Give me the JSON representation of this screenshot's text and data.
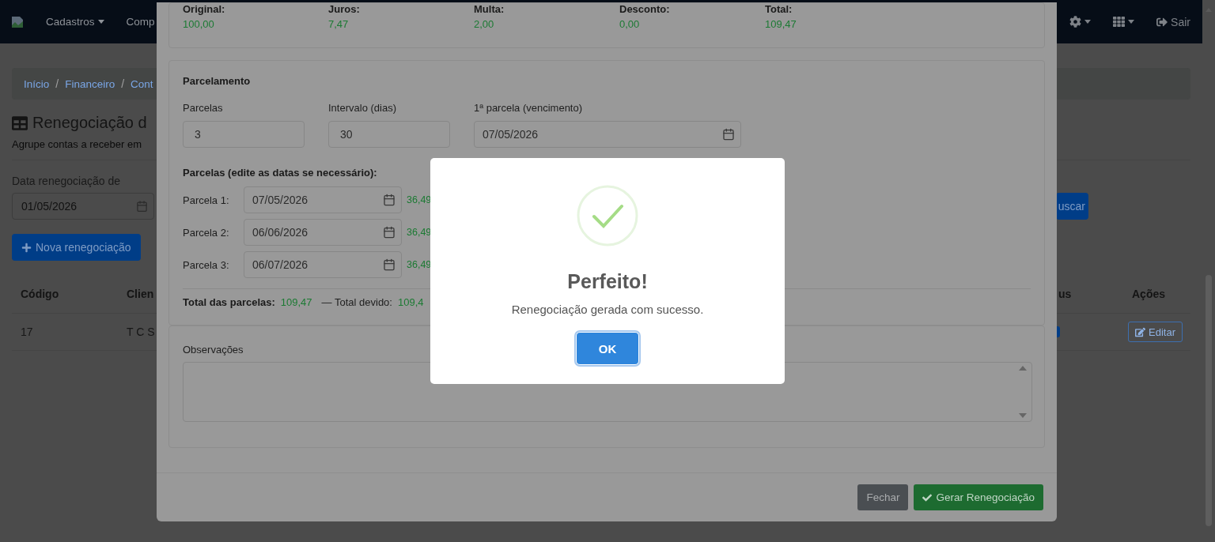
{
  "navbar": {
    "menus": [
      {
        "label": "Cadastros",
        "caret": true
      },
      {
        "label": "Comp",
        "caret": false
      }
    ],
    "logout": "Sair"
  },
  "breadcrumb": {
    "separator": "/",
    "items": [
      "Início",
      "Financeiro",
      "Cont"
    ]
  },
  "page": {
    "title": "Renegociação d",
    "subtitle": "Agrupe contas a receber em",
    "filter_label": "Data renegociação de",
    "filter_value": "01/05/2026",
    "search_button": "uscar",
    "new_button": "Nova renegociação"
  },
  "table": {
    "columns": [
      "Código",
      "Clien",
      "us",
      "Ações"
    ],
    "rows": [
      {
        "cells": [
          "17",
          "T C S"
        ],
        "action": "Editar"
      }
    ]
  },
  "modal": {
    "summary": [
      {
        "label": "Original:",
        "value": "100,00"
      },
      {
        "label": "Juros:",
        "value": "7,47"
      },
      {
        "label": "Multa:",
        "value": "2,00"
      },
      {
        "label": "Desconto:",
        "value": "0,00"
      },
      {
        "label": "Total:",
        "value": "109,47"
      }
    ],
    "plan": {
      "title": "Parcelamento",
      "fields": [
        {
          "label": "Parcelas",
          "value": "3",
          "kind": "number"
        },
        {
          "label": "Intervalo (dias)",
          "value": "30",
          "kind": "number"
        },
        {
          "label": "1ª parcela (vencimento)",
          "value": "07/05/2026",
          "kind": "date"
        }
      ],
      "list_title": "Parcelas (edite as datas se necessário):",
      "installments": [
        {
          "label": "Parcela 1:",
          "date": "07/05/2026",
          "amount": "36,49"
        },
        {
          "label": "Parcela 2:",
          "date": "06/06/2026",
          "amount": "36,49"
        },
        {
          "label": "Parcela 3:",
          "date": "06/07/2026",
          "amount": "36,49"
        }
      ],
      "total_label": "Total das parcelas:",
      "total_value": "109,47",
      "due_label": "— Total devido:",
      "due_value": "109,4"
    },
    "notes": {
      "label": "Observações"
    },
    "buttons": [
      {
        "label": "Fechar",
        "kind": "secondary"
      },
      {
        "label": "Gerar Renegociação",
        "kind": "success"
      }
    ]
  },
  "alert": {
    "kind": "success",
    "title": "Perfeito!",
    "text": "Renegociação gerada com sucesso.",
    "button": "OK"
  }
}
